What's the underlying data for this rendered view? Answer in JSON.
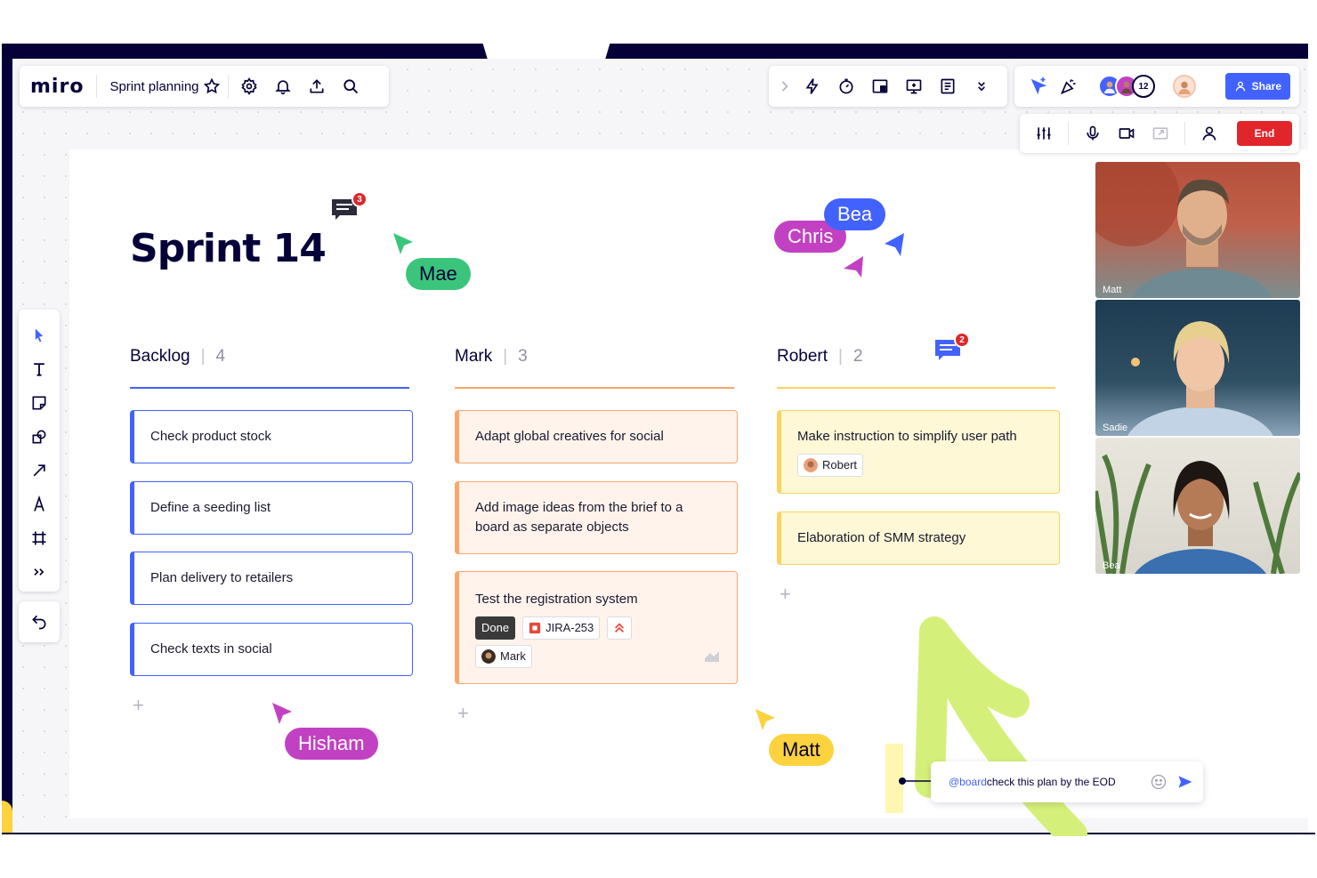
{
  "header": {
    "logo": "miro",
    "board_title": "Sprint planning",
    "share_label": "Share",
    "collaborator_count": "12",
    "end_label": "End"
  },
  "board": {
    "title": "Sprint 14",
    "columns": [
      {
        "name": "Backlog",
        "count": "4",
        "color": "#4262ff",
        "cards": [
          "Check product stock",
          "Define a seeding list",
          "Plan delivery to retailers",
          "Check texts in social"
        ]
      },
      {
        "name": "Mark",
        "count": "3",
        "color": "#fba76a",
        "cards": [
          "Adapt global creatives for social",
          "Add image ideas from the brief to a board as separate objects",
          "Test the registration system"
        ]
      },
      {
        "name": "Robert",
        "count": "2",
        "color": "#fcd35e",
        "cards": [
          "Make instruction to simplify user path",
          "Elaboration of SMM strategy"
        ]
      }
    ],
    "card_tags": {
      "robert_assignee": "Robert",
      "status": "Done",
      "jira": "JIRA-253",
      "mark_assignee": "Mark"
    },
    "comments": [
      {
        "count": "3"
      },
      {
        "count": "2"
      }
    ]
  },
  "cursors": [
    {
      "name": "Mae",
      "color": "#3bc57c"
    },
    {
      "name": "Bea",
      "color": "#4262ff"
    },
    {
      "name": "Chris",
      "color": "#c241c2"
    },
    {
      "name": "Hisham",
      "color": "#c241c2"
    },
    {
      "name": "Matt",
      "color": "#fcd33e"
    }
  ],
  "video_call": {
    "participants": [
      "Matt",
      "Sadie",
      "Bea"
    ]
  },
  "chat": {
    "mention": "@board",
    "message": " check this plan by the EOD"
  },
  "icons": [
    "star-icon",
    "settings-icon",
    "bell-icon",
    "upload-icon",
    "search-icon",
    "chevron-right-icon",
    "lightning-icon",
    "timer-icon",
    "embed-icon",
    "presentation-icon",
    "notes-icon",
    "chevrons-down-icon",
    "follow-cursor-icon",
    "reactions-icon",
    "user-icon",
    "sliders-icon",
    "microphone-icon",
    "camera-icon",
    "share-screen-icon",
    "person-icon",
    "select-icon",
    "text-icon",
    "sticky-note-icon",
    "shapes-icon",
    "arrow-icon",
    "pen-icon",
    "frame-icon",
    "more-tools-icon",
    "undo-icon",
    "emoji-icon",
    "send-icon",
    "jira-icon",
    "priority-icon"
  ]
}
